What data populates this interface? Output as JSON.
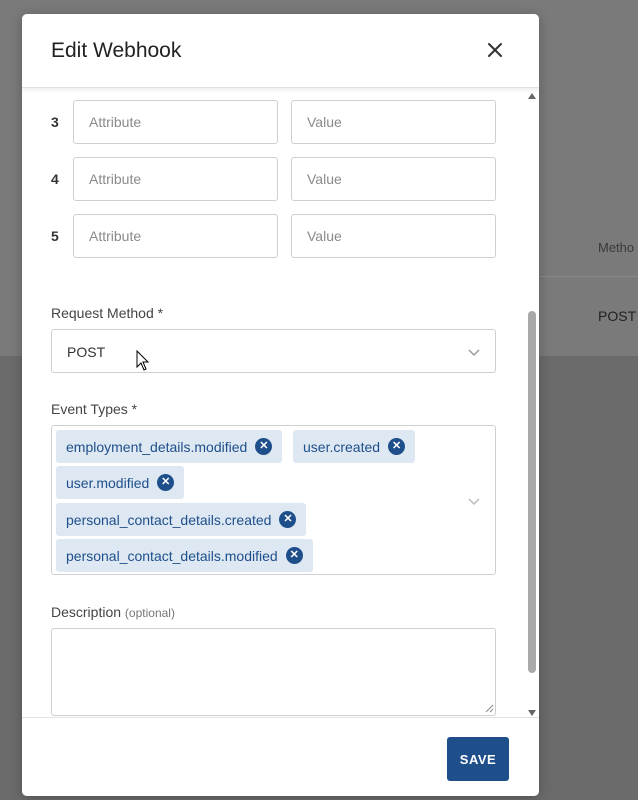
{
  "background": {
    "column_header": "Metho",
    "cell_value": "POST"
  },
  "modal": {
    "title": "Edit Webhook",
    "attributes": [
      {
        "index": "3",
        "attribute_placeholder": "Attribute",
        "value_placeholder": "Value"
      },
      {
        "index": "4",
        "attribute_placeholder": "Attribute",
        "value_placeholder": "Value"
      },
      {
        "index": "5",
        "attribute_placeholder": "Attribute",
        "value_placeholder": "Value"
      }
    ],
    "request_method": {
      "label": "Request Method *",
      "value": "POST"
    },
    "event_types": {
      "label": "Event Types *",
      "tags": [
        "employment_details.modified",
        "user.created",
        "user.modified",
        "personal_contact_details.created",
        "personal_contact_details.modified"
      ]
    },
    "description": {
      "label": "Description",
      "optional": "(optional)"
    },
    "save_label": "SAVE"
  },
  "colors": {
    "primary": "#1f4f8b",
    "tag_background": "#dde8f3"
  },
  "icons": [
    "close-icon",
    "chevron-down-icon",
    "tag-remove-icon",
    "resize-grip-icon",
    "scroll-up-icon",
    "scroll-down-icon",
    "mouse-cursor-icon"
  ]
}
